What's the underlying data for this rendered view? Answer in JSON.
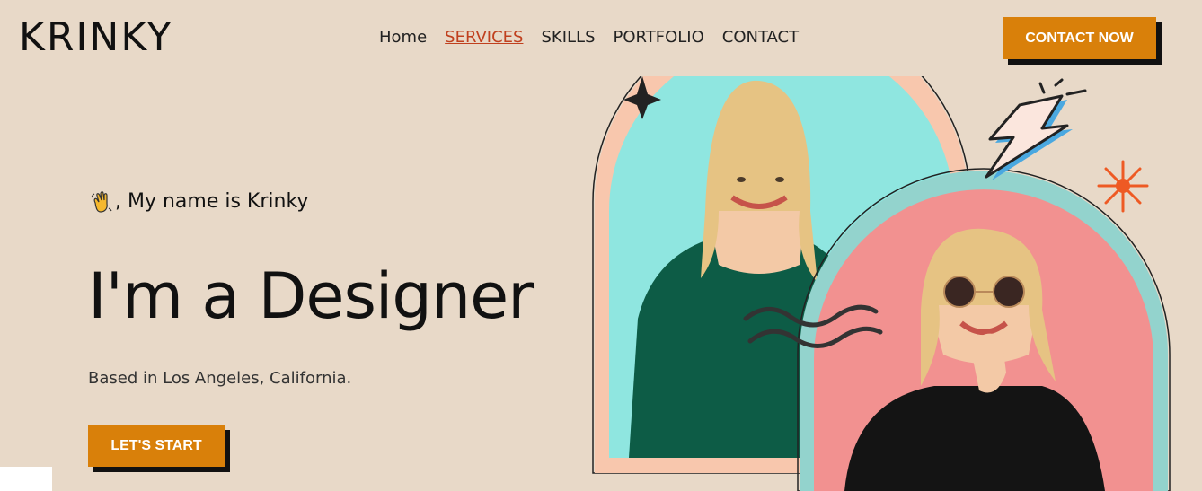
{
  "brand": {
    "logo": "KRINKY"
  },
  "nav": {
    "items": [
      {
        "label": "Home",
        "active": false
      },
      {
        "label": "SERVICES",
        "active": true
      },
      {
        "label": "SKILLS",
        "active": false
      },
      {
        "label": "PORTFOLIO",
        "active": false
      },
      {
        "label": "CONTACT",
        "active": false
      }
    ]
  },
  "header": {
    "cta_label": "CONTACT NOW"
  },
  "hero": {
    "greeting": ", My name is Krinky",
    "greeting_icon": "waving-hand-icon",
    "headline": "I'm a Designer",
    "subtitle": "Based in Los Angeles, California.",
    "cta_label": "LET'S START"
  },
  "colors": {
    "background": "#e8d9c8",
    "accent": "#d9800a",
    "nav_active": "#c0401e",
    "arch_peach": "#f8c7ad",
    "arch_teal": "#93d3cd",
    "photo_cyan": "#8fe6e0",
    "photo_pink": "#f29190"
  }
}
